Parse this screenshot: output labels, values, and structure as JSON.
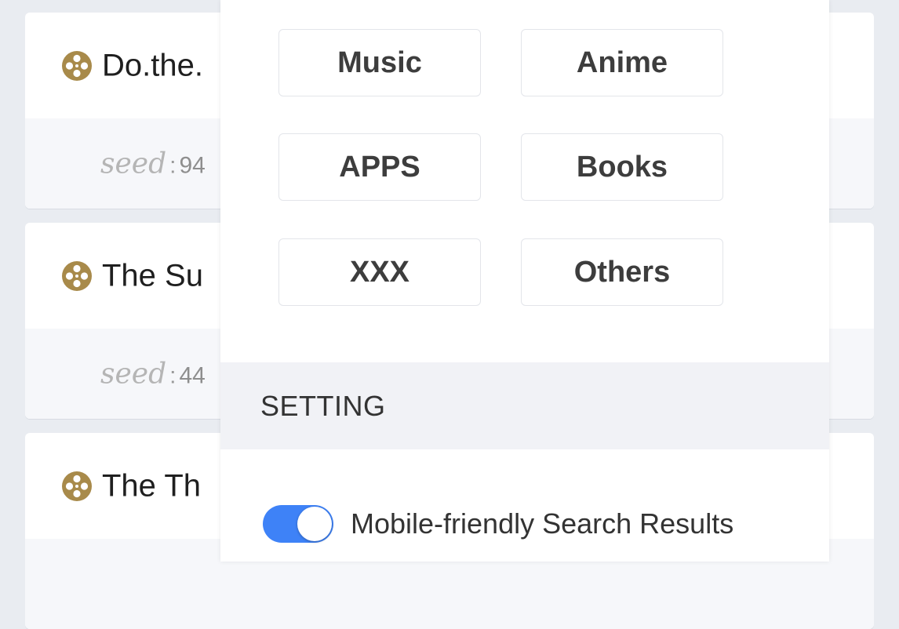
{
  "results": [
    {
      "title": "Do.the.",
      "seed_label": "seed",
      "seed_value": "94"
    },
    {
      "title": "The Su",
      "seed_label": "seed",
      "seed_value": "44"
    },
    {
      "title": "The Th"
    }
  ],
  "categories": [
    {
      "label": "Music"
    },
    {
      "label": "Anime"
    },
    {
      "label": "APPS"
    },
    {
      "label": "Books"
    },
    {
      "label": "XXX"
    },
    {
      "label": "Others"
    }
  ],
  "setting": {
    "title": "SETTING",
    "mobile_friendly_label": "Mobile-friendly Search Results",
    "mobile_friendly_enabled": true
  },
  "colors": {
    "toggle_on": "#3e82f7",
    "reel_icon": "#a88a4a"
  },
  "icons": {
    "result_icon": "film-reel-icon"
  }
}
